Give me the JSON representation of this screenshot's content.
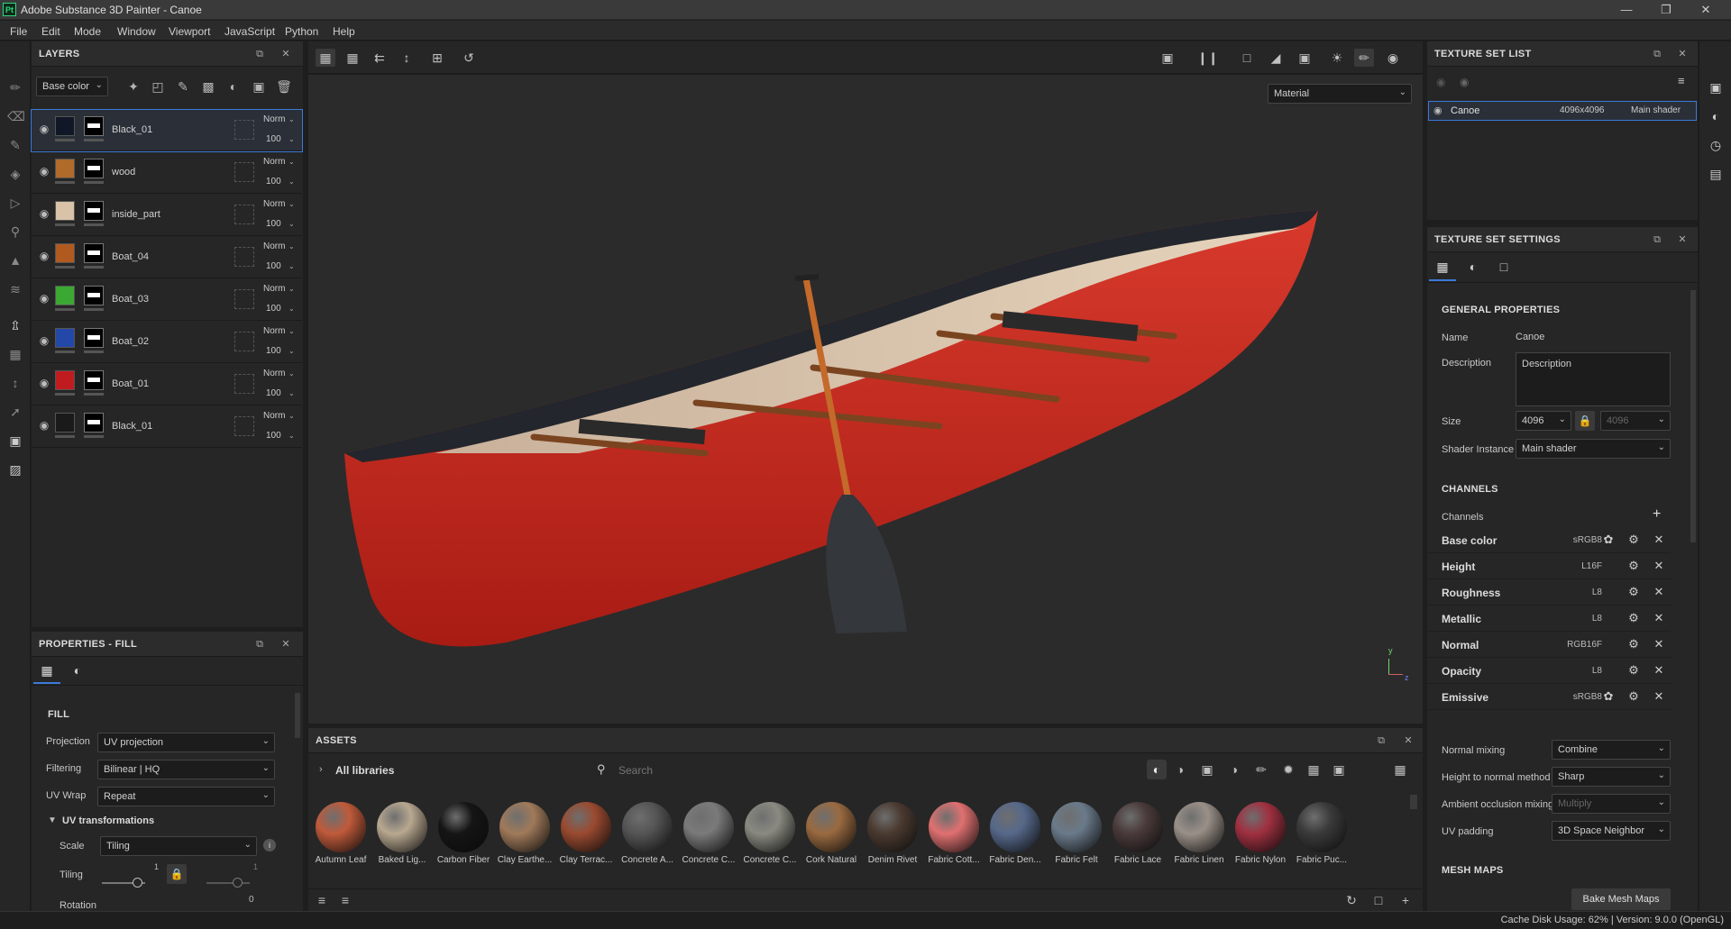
{
  "app": {
    "title": "Adobe Substance 3D Painter - Canoe",
    "logo": "Pt"
  },
  "menu": [
    "File",
    "Edit",
    "Mode",
    "Window",
    "Viewport",
    "JavaScript",
    "Python",
    "Help"
  ],
  "layers_panel": {
    "title": "LAYERS",
    "channel_select": "Base color",
    "layers": [
      {
        "name": "Black_01",
        "color": "#101828",
        "blend": "Norm",
        "opacity": "100"
      },
      {
        "name": "wood",
        "color": "#b06a2a",
        "blend": "Norm",
        "opacity": "100"
      },
      {
        "name": "inside_part",
        "color": "#d8c2a8",
        "blend": "Norm",
        "opacity": "100"
      },
      {
        "name": "Boat_04",
        "color": "#b05a20",
        "blend": "Norm",
        "opacity": "100"
      },
      {
        "name": "Boat_03",
        "color": "#3aa832",
        "blend": "Norm",
        "opacity": "100"
      },
      {
        "name": "Boat_02",
        "color": "#2448a8",
        "blend": "Norm",
        "opacity": "100"
      },
      {
        "name": "Boat_01",
        "color": "#c01c20",
        "blend": "Norm",
        "opacity": "100"
      },
      {
        "name": "Black_01",
        "color": "#1a1a1a",
        "blend": "Norm",
        "opacity": "100"
      }
    ]
  },
  "properties": {
    "title": "PROPERTIES - FILL",
    "section": "FILL",
    "projection_label": "Projection",
    "projection_value": "UV projection",
    "filtering_label": "Filtering",
    "filtering_value": "Bilinear | HQ",
    "uvwrap_label": "UV Wrap",
    "uvwrap_value": "Repeat",
    "uvtrans_label": "UV transformations",
    "scale_label": "Scale",
    "scale_value": "Tiling",
    "tiling_label": "Tiling",
    "tiling_left_value": "1",
    "tiling_right_value": "1",
    "tiling_bottom_value": "0",
    "rotation_label": "Rotation"
  },
  "viewport": {
    "material_mode": "Material",
    "axis_y": "y",
    "axis_z": "z"
  },
  "assets": {
    "title": "ASSETS",
    "breadcrumb": "All libraries",
    "search_placeholder": "Search",
    "materials": [
      {
        "name": "Autumn Leaf",
        "color": "#c05a3a"
      },
      {
        "name": "Baked Lig...",
        "color": "#b8a890"
      },
      {
        "name": "Carbon Fiber",
        "color": "#151515"
      },
      {
        "name": "Clay Earthe...",
        "color": "#a07a5a"
      },
      {
        "name": "Clay Terrac...",
        "color": "#9a4a30"
      },
      {
        "name": "Concrete A...",
        "color": "#555555"
      },
      {
        "name": "Concrete C...",
        "color": "#7a7a7a"
      },
      {
        "name": "Concrete C...",
        "color": "#8a8a82"
      },
      {
        "name": "Cork Natural",
        "color": "#9a6a40"
      },
      {
        "name": "Denim Rivet",
        "color": "#4a3a30"
      },
      {
        "name": "Fabric Cott...",
        "color": "#e07070"
      },
      {
        "name": "Fabric Den...",
        "color": "#56688a"
      },
      {
        "name": "Fabric Felt",
        "color": "#6a7a8a"
      },
      {
        "name": "Fabric Lace",
        "color": "#4a3a3a"
      },
      {
        "name": "Fabric Linen",
        "color": "#9a9088"
      },
      {
        "name": "Fabric Nylon",
        "color": "#a03040"
      },
      {
        "name": "Fabric Puc...",
        "color": "#3a3a3a"
      }
    ]
  },
  "texture_set_list": {
    "title": "TEXTURE SET LIST",
    "item": {
      "name": "Canoe",
      "size": "4096x4096",
      "shader": "Main shader"
    }
  },
  "texture_set_settings": {
    "title": "TEXTURE SET SETTINGS",
    "general": "GENERAL PROPERTIES",
    "name_label": "Name",
    "name_value": "Canoe",
    "desc_label": "Description",
    "desc_value": "Description",
    "size_label": "Size",
    "size_value": "4096",
    "size_value2": "4096",
    "shader_label": "Shader Instance",
    "shader_value": "Main shader",
    "channels_title": "CHANNELS",
    "channels_label": "Channels",
    "channels": [
      {
        "name": "Base color",
        "format": "sRGB8"
      },
      {
        "name": "Height",
        "format": "L16F"
      },
      {
        "name": "Roughness",
        "format": "L8"
      },
      {
        "name": "Metallic",
        "format": "L8"
      },
      {
        "name": "Normal",
        "format": "RGB16F"
      },
      {
        "name": "Opacity",
        "format": "L8"
      },
      {
        "name": "Emissive",
        "format": "sRGB8"
      }
    ],
    "normal_mixing_label": "Normal mixing",
    "normal_mixing_value": "Combine",
    "h2n_label": "Height to normal method",
    "h2n_value": "Sharp",
    "ao_label": "Ambient occlusion mixing",
    "ao_value": "Multiply",
    "uvpad_label": "UV padding",
    "uvpad_value": "3D Space Neighbor",
    "mesh_maps_title": "MESH MAPS",
    "bake_button": "Bake Mesh Maps"
  },
  "status": {
    "text": "Cache Disk Usage:   62% | Version: 9.0.0 (OpenGL)"
  }
}
